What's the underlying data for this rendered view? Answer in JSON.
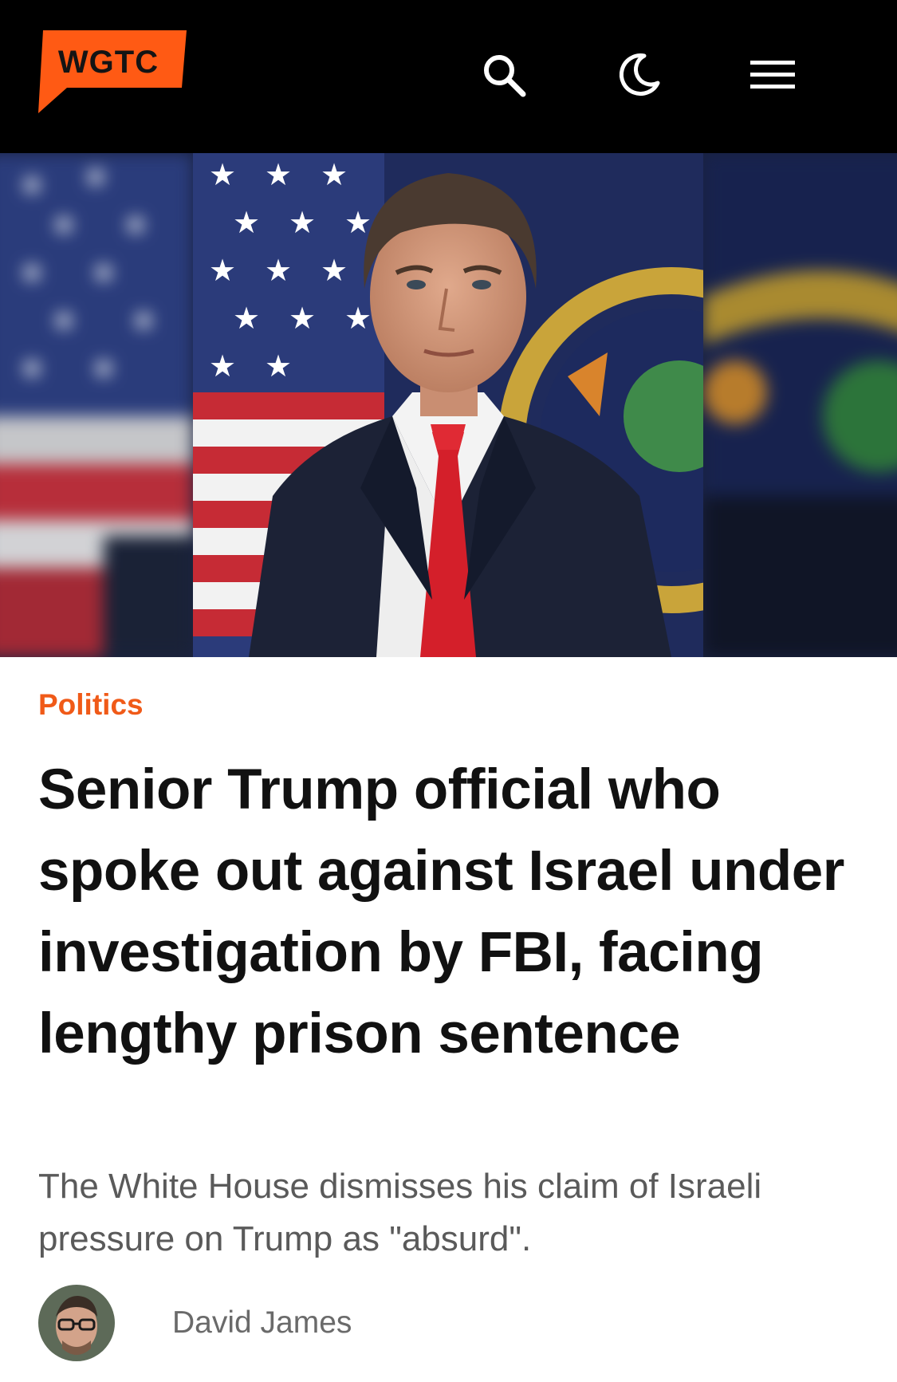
{
  "header": {
    "logo_text": "WGTC",
    "brand_color": "#ff5a14",
    "background": "#000000",
    "icons": [
      "search-icon",
      "moon-icon",
      "hamburger-menu-icon"
    ]
  },
  "hero": {
    "image": "official-portrait-photo"
  },
  "article": {
    "category": "Politics",
    "category_color": "#f05a18",
    "headline": "Senior Trump official who spoke out against Israel under investigation by FBI, facing lengthy prison sentence",
    "subheadline": "The White House dismisses his claim of Israeli pressure on Trump as \"absurd\".",
    "author": "David James"
  }
}
